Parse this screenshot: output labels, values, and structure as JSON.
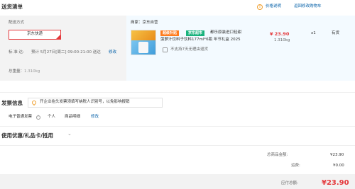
{
  "header": {
    "title": "送货清单",
    "price_note": "价格说明",
    "back_to_cart": "返回修改购物车"
  },
  "shipping": {
    "method_label": "配送方式",
    "method_value": "京东快递",
    "delivery_prefix": "标 准 达:",
    "delivery_time": "预计 5月27日[周二] 09:00-21:00 送达",
    "modify": "修改",
    "weight_label": "总重量：",
    "weight_value": "1.310kg"
  },
  "store": {
    "label": "商家：京东自营"
  },
  "product": {
    "tag_promo": "超级补贴",
    "tag_brand": "京东超市",
    "title_line1": "都乐原装进口轻甜",
    "title_line2": "菠萝汁饮料子饮料177ml*6瓶 年节礼盒 2025",
    "price": "¥ 23.90",
    "weight": "1.310kg",
    "quantity": "x1",
    "stock": "有货",
    "no_return": "不支持7天无理由退货"
  },
  "invoice": {
    "title": "发票信息",
    "tip": "开企业抬头发票须填写纳税人识别号，以免影响报销",
    "type": "电子普通发票",
    "holder": "个人",
    "content": "商品明细",
    "modify": "修改"
  },
  "coupons": {
    "title": "使用优惠/礼品卡/抵用"
  },
  "summary": {
    "total_label": "总商品金额:",
    "total_value": "¥23.90",
    "freight_label": "运费:",
    "freight_value": "¥0.00",
    "pay_label": "应付总额:",
    "pay_value": "¥23.90"
  },
  "colors": {
    "accent_red": "#e4393c",
    "link_blue": "#005ea7",
    "panel_gray": "#f3f3f3",
    "panel_blue": "#f3faff"
  }
}
